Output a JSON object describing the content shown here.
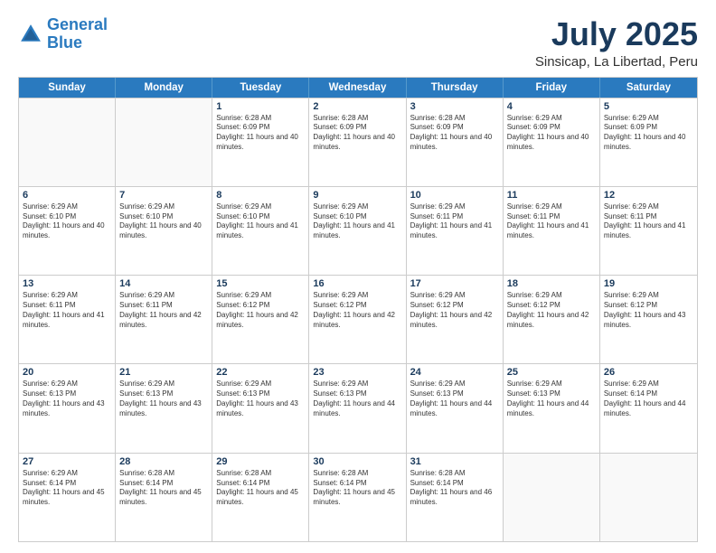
{
  "header": {
    "logo_general": "General",
    "logo_blue": "Blue",
    "month_title": "July 2025",
    "location": "Sinsicap, La Libertad, Peru"
  },
  "weekdays": [
    "Sunday",
    "Monday",
    "Tuesday",
    "Wednesday",
    "Thursday",
    "Friday",
    "Saturday"
  ],
  "weeks": [
    [
      {
        "day": "",
        "empty": true
      },
      {
        "day": "",
        "empty": true
      },
      {
        "day": "1",
        "sunrise": "Sunrise: 6:28 AM",
        "sunset": "Sunset: 6:09 PM",
        "daylight": "Daylight: 11 hours and 40 minutes."
      },
      {
        "day": "2",
        "sunrise": "Sunrise: 6:28 AM",
        "sunset": "Sunset: 6:09 PM",
        "daylight": "Daylight: 11 hours and 40 minutes."
      },
      {
        "day": "3",
        "sunrise": "Sunrise: 6:28 AM",
        "sunset": "Sunset: 6:09 PM",
        "daylight": "Daylight: 11 hours and 40 minutes."
      },
      {
        "day": "4",
        "sunrise": "Sunrise: 6:29 AM",
        "sunset": "Sunset: 6:09 PM",
        "daylight": "Daylight: 11 hours and 40 minutes."
      },
      {
        "day": "5",
        "sunrise": "Sunrise: 6:29 AM",
        "sunset": "Sunset: 6:09 PM",
        "daylight": "Daylight: 11 hours and 40 minutes."
      }
    ],
    [
      {
        "day": "6",
        "sunrise": "Sunrise: 6:29 AM",
        "sunset": "Sunset: 6:10 PM",
        "daylight": "Daylight: 11 hours and 40 minutes."
      },
      {
        "day": "7",
        "sunrise": "Sunrise: 6:29 AM",
        "sunset": "Sunset: 6:10 PM",
        "daylight": "Daylight: 11 hours and 40 minutes."
      },
      {
        "day": "8",
        "sunrise": "Sunrise: 6:29 AM",
        "sunset": "Sunset: 6:10 PM",
        "daylight": "Daylight: 11 hours and 41 minutes."
      },
      {
        "day": "9",
        "sunrise": "Sunrise: 6:29 AM",
        "sunset": "Sunset: 6:10 PM",
        "daylight": "Daylight: 11 hours and 41 minutes."
      },
      {
        "day": "10",
        "sunrise": "Sunrise: 6:29 AM",
        "sunset": "Sunset: 6:11 PM",
        "daylight": "Daylight: 11 hours and 41 minutes."
      },
      {
        "day": "11",
        "sunrise": "Sunrise: 6:29 AM",
        "sunset": "Sunset: 6:11 PM",
        "daylight": "Daylight: 11 hours and 41 minutes."
      },
      {
        "day": "12",
        "sunrise": "Sunrise: 6:29 AM",
        "sunset": "Sunset: 6:11 PM",
        "daylight": "Daylight: 11 hours and 41 minutes."
      }
    ],
    [
      {
        "day": "13",
        "sunrise": "Sunrise: 6:29 AM",
        "sunset": "Sunset: 6:11 PM",
        "daylight": "Daylight: 11 hours and 41 minutes."
      },
      {
        "day": "14",
        "sunrise": "Sunrise: 6:29 AM",
        "sunset": "Sunset: 6:11 PM",
        "daylight": "Daylight: 11 hours and 42 minutes."
      },
      {
        "day": "15",
        "sunrise": "Sunrise: 6:29 AM",
        "sunset": "Sunset: 6:12 PM",
        "daylight": "Daylight: 11 hours and 42 minutes."
      },
      {
        "day": "16",
        "sunrise": "Sunrise: 6:29 AM",
        "sunset": "Sunset: 6:12 PM",
        "daylight": "Daylight: 11 hours and 42 minutes."
      },
      {
        "day": "17",
        "sunrise": "Sunrise: 6:29 AM",
        "sunset": "Sunset: 6:12 PM",
        "daylight": "Daylight: 11 hours and 42 minutes."
      },
      {
        "day": "18",
        "sunrise": "Sunrise: 6:29 AM",
        "sunset": "Sunset: 6:12 PM",
        "daylight": "Daylight: 11 hours and 42 minutes."
      },
      {
        "day": "19",
        "sunrise": "Sunrise: 6:29 AM",
        "sunset": "Sunset: 6:12 PM",
        "daylight": "Daylight: 11 hours and 43 minutes."
      }
    ],
    [
      {
        "day": "20",
        "sunrise": "Sunrise: 6:29 AM",
        "sunset": "Sunset: 6:13 PM",
        "daylight": "Daylight: 11 hours and 43 minutes."
      },
      {
        "day": "21",
        "sunrise": "Sunrise: 6:29 AM",
        "sunset": "Sunset: 6:13 PM",
        "daylight": "Daylight: 11 hours and 43 minutes."
      },
      {
        "day": "22",
        "sunrise": "Sunrise: 6:29 AM",
        "sunset": "Sunset: 6:13 PM",
        "daylight": "Daylight: 11 hours and 43 minutes."
      },
      {
        "day": "23",
        "sunrise": "Sunrise: 6:29 AM",
        "sunset": "Sunset: 6:13 PM",
        "daylight": "Daylight: 11 hours and 44 minutes."
      },
      {
        "day": "24",
        "sunrise": "Sunrise: 6:29 AM",
        "sunset": "Sunset: 6:13 PM",
        "daylight": "Daylight: 11 hours and 44 minutes."
      },
      {
        "day": "25",
        "sunrise": "Sunrise: 6:29 AM",
        "sunset": "Sunset: 6:13 PM",
        "daylight": "Daylight: 11 hours and 44 minutes."
      },
      {
        "day": "26",
        "sunrise": "Sunrise: 6:29 AM",
        "sunset": "Sunset: 6:14 PM",
        "daylight": "Daylight: 11 hours and 44 minutes."
      }
    ],
    [
      {
        "day": "27",
        "sunrise": "Sunrise: 6:29 AM",
        "sunset": "Sunset: 6:14 PM",
        "daylight": "Daylight: 11 hours and 45 minutes."
      },
      {
        "day": "28",
        "sunrise": "Sunrise: 6:28 AM",
        "sunset": "Sunset: 6:14 PM",
        "daylight": "Daylight: 11 hours and 45 minutes."
      },
      {
        "day": "29",
        "sunrise": "Sunrise: 6:28 AM",
        "sunset": "Sunset: 6:14 PM",
        "daylight": "Daylight: 11 hours and 45 minutes."
      },
      {
        "day": "30",
        "sunrise": "Sunrise: 6:28 AM",
        "sunset": "Sunset: 6:14 PM",
        "daylight": "Daylight: 11 hours and 45 minutes."
      },
      {
        "day": "31",
        "sunrise": "Sunrise: 6:28 AM",
        "sunset": "Sunset: 6:14 PM",
        "daylight": "Daylight: 11 hours and 46 minutes."
      },
      {
        "day": "",
        "empty": true
      },
      {
        "day": "",
        "empty": true
      }
    ]
  ]
}
